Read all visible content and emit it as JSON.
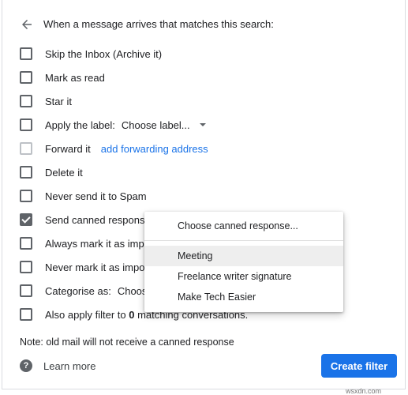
{
  "header": {
    "title": "When a message arrives that matches this search:"
  },
  "options": {
    "skip_inbox": "Skip the Inbox (Archive it)",
    "mark_read": "Mark as read",
    "star": "Star it",
    "apply_label": "Apply the label:",
    "label_select": "Choose label...",
    "forward": "Forward it",
    "forward_link": "add forwarding address",
    "delete": "Delete it",
    "never_spam": "Never send it to Spam",
    "canned": "Send canned response:",
    "always_important": "Always mark it as import",
    "never_important": "Never mark it as importa",
    "categorise": "Categorise as:",
    "categorise_select": "Choose c",
    "also_apply_prefix": "Also apply filter to",
    "also_apply_count": "0",
    "also_apply_suffix": "matching conversations."
  },
  "note": "Note: old mail will not receive a canned response",
  "learn_more": "Learn more",
  "create_filter": "Create filter",
  "canned_menu": {
    "items": [
      "Choose canned response...",
      "Meeting",
      "Freelance writer signature",
      "Make Tech Easier"
    ],
    "highlighted_index": 1
  },
  "watermark": "wsxdn.com",
  "colors": {
    "accent": "#1a73e8",
    "text": "#202124",
    "icon": "#5f6368"
  }
}
